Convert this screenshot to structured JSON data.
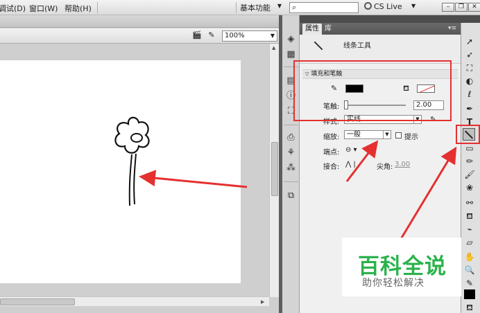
{
  "menu": {
    "items": [
      "调试(D)",
      "窗口(W)",
      "帮助(H)"
    ]
  },
  "workspace": {
    "label": "基本功能"
  },
  "search": {
    "placeholder": ""
  },
  "cs_live": {
    "label": "CS Live"
  },
  "stage": {
    "zoom": "100%"
  },
  "panel": {
    "tabs": [
      "属性",
      "库"
    ],
    "tool_name": "线条工具",
    "section_title": "填充和笔触",
    "stroke_size_label": "笔触:",
    "stroke_size_value": "2.00",
    "style_label": "样式:",
    "style_value": "实线",
    "scale_label": "缩放:",
    "scale_value": "一般",
    "hint_label": "提示",
    "cap_label": "端点:",
    "join_label": "接合:",
    "miter_label": "尖角:",
    "miter_value": "3.00",
    "stroke_color": "#000000",
    "fill_color": "none"
  },
  "watermark": {
    "title": "百科全说",
    "subtitle": "助你轻松解决"
  },
  "annotation": {
    "color": "#e53030"
  }
}
